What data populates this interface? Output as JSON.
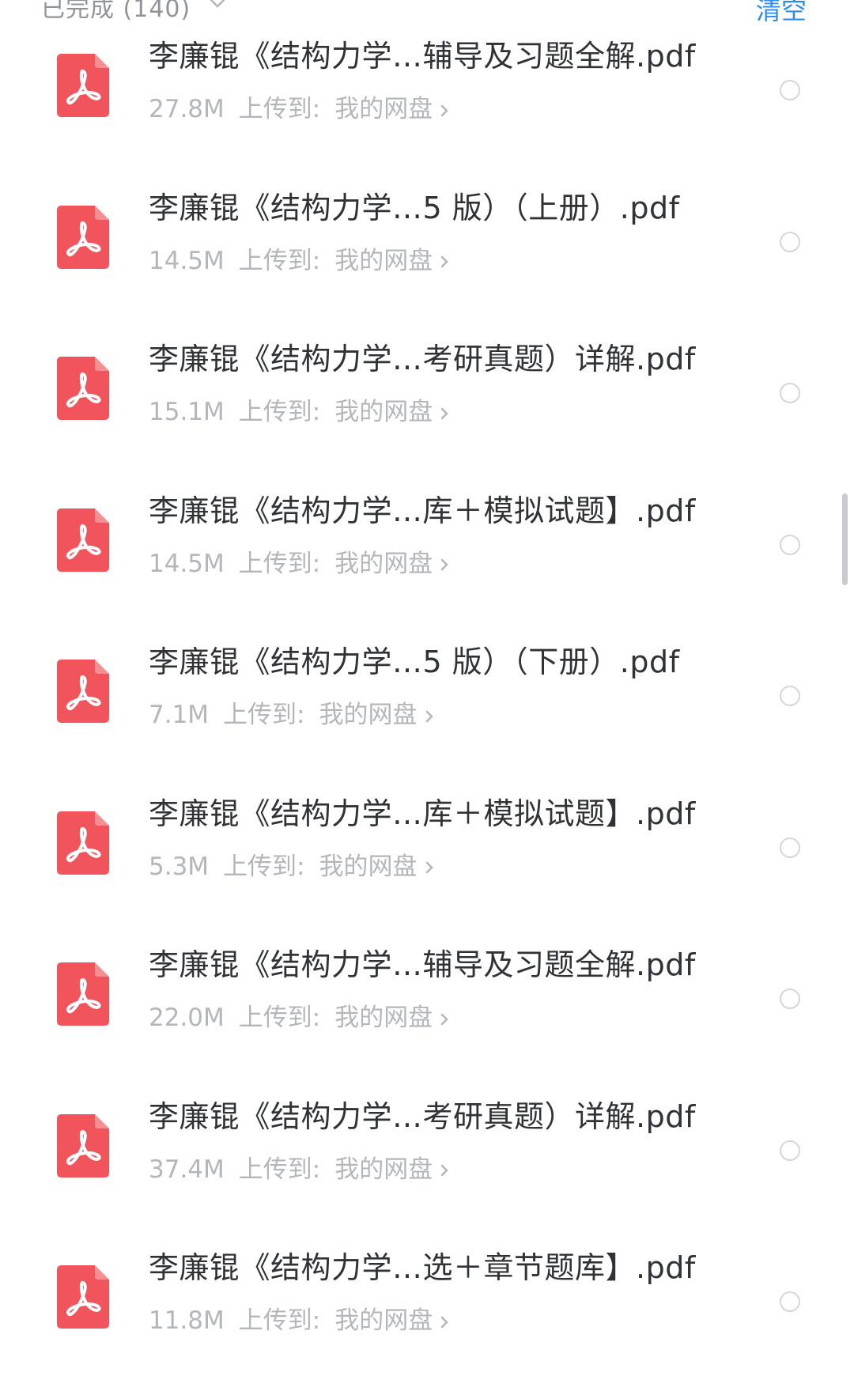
{
  "header": {
    "title": "已完成 (140)",
    "clear_label": "清空"
  },
  "items": [
    {
      "name": "李廉锟《结构力学…辅导及习题全解.pdf",
      "size": "27.8M",
      "upload_label": "上传到:",
      "location": "我的网盘"
    },
    {
      "name": "李廉锟《结构力学…5 版）（上册）.pdf",
      "size": "14.5M",
      "upload_label": "上传到:",
      "location": "我的网盘"
    },
    {
      "name": "李廉锟《结构力学…考研真题）详解.pdf",
      "size": "15.1M",
      "upload_label": "上传到:",
      "location": "我的网盘"
    },
    {
      "name": "李廉锟《结构力学…库＋模拟试题】.pdf",
      "size": "14.5M",
      "upload_label": "上传到:",
      "location": "我的网盘"
    },
    {
      "name": "李廉锟《结构力学…5 版）（下册）.pdf",
      "size": "7.1M",
      "upload_label": "上传到:",
      "location": "我的网盘"
    },
    {
      "name": "李廉锟《结构力学…库＋模拟试题】.pdf",
      "size": "5.3M",
      "upload_label": "上传到:",
      "location": "我的网盘"
    },
    {
      "name": "李廉锟《结构力学…辅导及习题全解.pdf",
      "size": "22.0M",
      "upload_label": "上传到:",
      "location": "我的网盘"
    },
    {
      "name": "李廉锟《结构力学…考研真题）详解.pdf",
      "size": "37.4M",
      "upload_label": "上传到:",
      "location": "我的网盘"
    },
    {
      "name": "李廉锟《结构力学…选＋章节题库】.pdf",
      "size": "11.8M",
      "upload_label": "上传到:",
      "location": "我的网盘"
    }
  ],
  "colors": {
    "pdf_icon": "#f2545b",
    "accent": "#2e8cf0",
    "title_text": "#2f3236",
    "meta_text": "#b3b7bc"
  },
  "icons": {
    "file": "pdf-icon",
    "select": "radio-circle-icon",
    "location_chevron": "chevron-right-icon",
    "header_chevron": "chevron-down-icon"
  }
}
